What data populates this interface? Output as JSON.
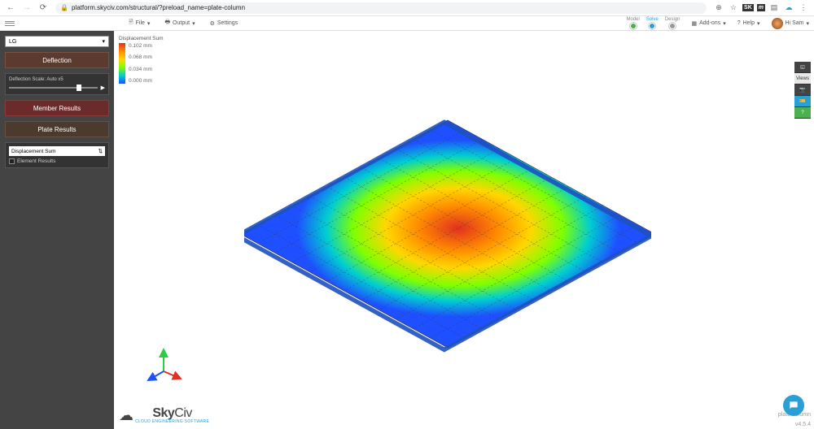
{
  "browser": {
    "url": "platform.skyciv.com/structural/?preload_name=plate-column",
    "badges": [
      "SK",
      "m"
    ]
  },
  "toolbar": {
    "file": "File",
    "output": "Output",
    "settings": "Settings",
    "modes": {
      "model": "Model",
      "solve": "Solve",
      "design": "Design"
    },
    "addons": "Add-ons",
    "help": "Help",
    "user": "Hi Sam"
  },
  "sidebar": {
    "load_group": "LG",
    "deflection": "Deflection",
    "scale_label": "Deflection Scale:",
    "scale_value": "Auto x5",
    "member_results": "Member Results",
    "plate_results": "Plate Results",
    "result_type": "Displacement Sum",
    "element_results": "Element Results"
  },
  "legend": {
    "title": "Displacement Sum",
    "ticks": [
      "0.102 mm",
      "0.068 mm",
      "0.034 mm",
      "0.000 mm"
    ]
  },
  "right_tools": {
    "views": "Views"
  },
  "footer": {
    "logo": "SkyCiv",
    "tagline": "CLOUD ENGINEERING SOFTWARE",
    "version": "v4.5.4",
    "file": "plate-column"
  },
  "chart_data": {
    "type": "heatmap",
    "title": "Displacement Sum",
    "unit": "mm",
    "min": 0.0,
    "max": 0.102,
    "colormap": [
      "#1e50ff",
      "#00ced1",
      "#7fff00",
      "#ffd700",
      "#ff8c00",
      "#e03020"
    ],
    "description": "Square plate FEA displacement contour, peak at center, fixed edges",
    "mesh": {
      "nx": 12,
      "ny": 12
    }
  }
}
